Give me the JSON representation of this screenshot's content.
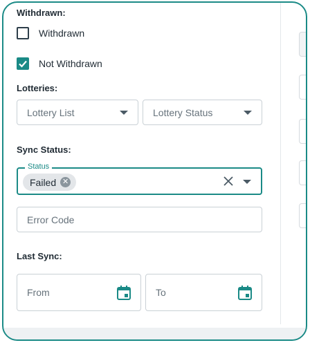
{
  "withdrawn": {
    "heading": "Withdrawn:",
    "options": [
      {
        "label": "Withdrawn",
        "checked": false
      },
      {
        "label": "Not Withdrawn",
        "checked": true
      }
    ]
  },
  "lotteries": {
    "heading": "Lotteries:",
    "lottery_list_placeholder": "Lottery List",
    "lottery_status_placeholder": "Lottery Status"
  },
  "sync_status": {
    "heading": "Sync Status:",
    "status_label": "Status",
    "selected_chip": "Failed",
    "error_code_placeholder": "Error Code"
  },
  "last_sync": {
    "heading": "Last Sync:",
    "from_placeholder": "From",
    "to_placeholder": "To"
  },
  "colors": {
    "accent": "#1a8a86",
    "border": "#c9d0d5",
    "text": "#1f2a33"
  }
}
